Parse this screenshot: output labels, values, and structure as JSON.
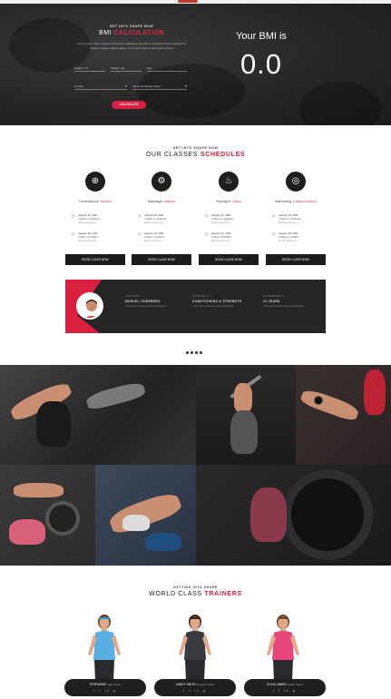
{
  "bmi": {
    "pretitle": "GET INTO SHAPE NOW",
    "title_plain": "BMI ",
    "title_highlight": "CALCULATION",
    "description": "Lorem ipsum dolor sit amet consectetur adipiscing elit sed do eiusmod tempor incididunt ut labore et dolore magna aliqua ut enim ad minim veniam quis nostrud",
    "fields": {
      "height": "Height / cm",
      "weight": "Weight / kg",
      "age": "Age",
      "sex": "Gender",
      "activity": "Select an activity factor"
    },
    "button": "CALCULATE",
    "result_label": "Your BMI is",
    "result_value": "0.0"
  },
  "classes": {
    "pretitle": "GET INTO SHAPE NOW",
    "title_plain": "OUR CLASSES ",
    "title_highlight": "SCHEDULES",
    "items": [
      {
        "name_plain": "Combination ",
        "name_highlight": "Station",
        "icon": "gym-icon",
        "glyph": "⊕",
        "sessions": [
          [
            "January 15, 2021",
            "7:00am to 11:00 am",
            "Marcel Guerrero"
          ],
          [
            "January 15, 2021",
            "2:00pm to 5:00pm",
            "Marcel Guerrero"
          ]
        ],
        "book": "BOOK CLASS NOW"
      },
      {
        "name_plain": "Massage ",
        "name_highlight": "Station",
        "icon": "fitness-icon",
        "glyph": "⚙",
        "sessions": [
          [
            "January 16, 2021",
            "7:00am to 11:00 am",
            "Marcel Guerrero"
          ],
          [
            "January 16, 2021",
            "2:00pm to 5:00pm",
            "Marcel Guerrero"
          ]
        ],
        "book": "BOOK CLASS NOW"
      },
      {
        "name_plain": "Strength ",
        "name_highlight": "Class",
        "icon": "running-icon",
        "glyph": "♨",
        "sessions": [
          [
            "January 17, 2021",
            "7:00am to 11:00 am",
            "Marcel Guerrero"
          ],
          [
            "January 17, 2021",
            "2:00pm to 5:00pm",
            "Marcel Guerrero"
          ]
        ],
        "book": "BOOK CLASS NOW"
      },
      {
        "name_plain": "Swimming ",
        "name_highlight": "Championship",
        "icon": "cycling-icon",
        "glyph": "◎",
        "sessions": [
          [
            "January 18, 2021",
            "7:00am to 11:00 am",
            "Marcel Guerrero"
          ],
          [
            "January 18, 2021",
            "2:00pm to 5:00pm",
            "Marcel Guerrero"
          ]
        ],
        "book": "BOOK CLASS NOW"
      }
    ]
  },
  "banner": {
    "blocks": [
      {
        "heading": "TRAINER",
        "value": "MARCEL GUERRERO",
        "detail": "Lorem ipsum dolor sit amet consectetur"
      },
      {
        "heading": "SPECIALITY",
        "value": "CONDITIONING & STRENGTH",
        "detail": "Lorem ipsum dolor sit amet consectetur"
      },
      {
        "heading": "EXPERIENCE",
        "value": "10 YEARS",
        "detail": "Lorem ipsum dolor sit amet consectetur"
      }
    ]
  },
  "photos": [
    {
      "name": "photo-pushups"
    },
    {
      "name": "photo-squat"
    },
    {
      "name": "photo-smartwatch"
    },
    {
      "name": "photo-barbell"
    },
    {
      "name": "photo-situps"
    },
    {
      "name": "photo-tire"
    }
  ],
  "trainers": {
    "pretitle": "GETTING INTO SHAPE",
    "title_plain": "WORLD CLASS ",
    "title_highlight": "TRAINERS",
    "items": [
      {
        "name": "STEPHANIE",
        "role": "Yoga Trainer",
        "shirt": "#5ab0e2",
        "hair": "#5a3a22",
        "band": "#1e9ad6",
        "social": "f t in g"
      },
      {
        "name": "CANDY SMITH",
        "role": "Strength Trainer",
        "shirt": "#3a3a40",
        "hair": "#3b2416",
        "band": "#3b2416",
        "social": "f t in g"
      },
      {
        "name": "OLIVIA JAMES",
        "role": "Cardio Trainer",
        "shirt": "#e8467a",
        "hair": "#6a4526",
        "band": "#6a4526",
        "social": "f t in g"
      }
    ]
  },
  "colors": {
    "accent": "#d9203f",
    "dark": "#1c1c1c"
  }
}
